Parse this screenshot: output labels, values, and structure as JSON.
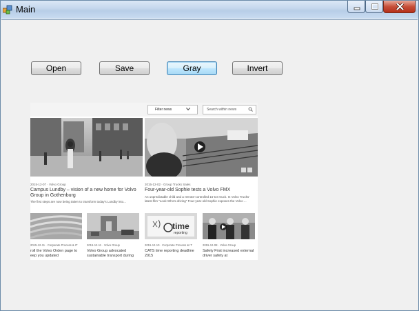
{
  "window": {
    "title": "Main",
    "icons": {
      "app": "winforms-app-icon",
      "minimize": "minimize-icon",
      "maximize": "maximize-icon",
      "close": "close-icon"
    }
  },
  "toolbar": {
    "open_label": "Open",
    "save_label": "Save",
    "gray_label": "Gray",
    "invert_label": "Invert",
    "focused_button": "Gray"
  },
  "picture": {
    "filter_label": "Filter news",
    "search_placeholder": "Search within news",
    "featured": [
      {
        "meta": "2015-12-07 · Volvo Group",
        "headline": "Campus Lundby – vision of a new home for Volvo Group in Gothenburg",
        "desc": "The first steps are now being taken to transform today's Lundby into..."
      },
      {
        "meta": "2015-12-02 · Group Trucks Sales",
        "headline": "Four-year-old Sophie tests a Volvo FMX",
        "desc": "An unpredictable child and a remote-controlled 15-ton truck. In Volvo Trucks' latest film \"Look Who's driving\" Four-year-old Sophie exposes the Volvo ..."
      }
    ],
    "small": [
      {
        "meta": "2015-12-11 · Corporate Process & IT",
        "headline": "roll the Volvo Orden page to eep you updated"
      },
      {
        "meta": "2015-12-11 · Volvo Group",
        "headline": "Volvo Group advocated sustainable transport during"
      },
      {
        "meta": "2015-12-10 · Corporate Process & IT",
        "headline": "CATS time reporting deadline 2015",
        "logo_text": "time",
        "logo_sub": "reporting"
      },
      {
        "meta": "2015-12-08 · Volvo Group",
        "headline": "Safety First increased external driver safety at"
      }
    ]
  }
}
